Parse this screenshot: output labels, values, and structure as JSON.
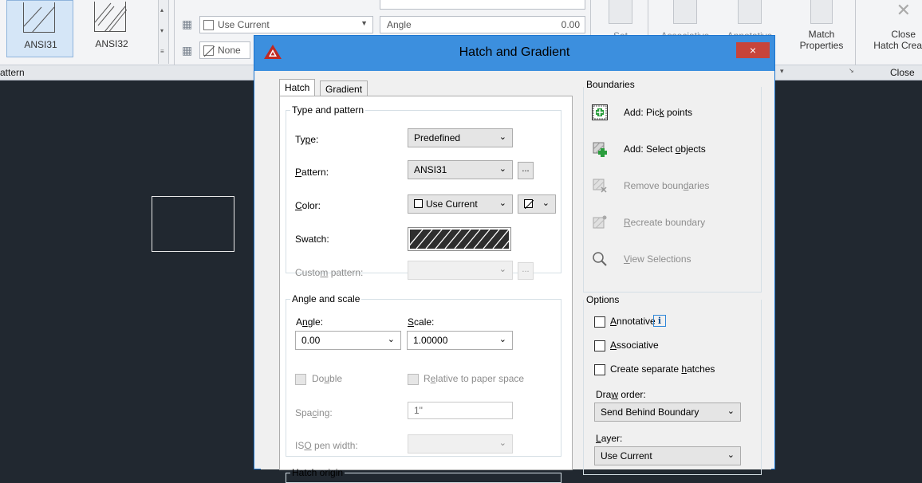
{
  "ribbon": {
    "patterns": [
      {
        "label": "ANSI31",
        "selected": true
      },
      {
        "label": "ANSI32",
        "selected": false
      }
    ],
    "layer_color": "Use Current",
    "bg_color": "None",
    "angle_label": "Angle",
    "angle_value": "0.00",
    "set_label": "Set",
    "associative_label": "Associative",
    "annotative_label": "Annotative",
    "match_props_label_1": "Match",
    "match_props_label_2": "Properties",
    "close_label_1": "Close",
    "close_label_2": "Hatch Crea",
    "footer_pattern": "attern",
    "footer_close": "Close"
  },
  "dialog": {
    "title": "Hatch and Gradient",
    "close_glyph": "×",
    "tabs": [
      {
        "label": "Hatch",
        "active": true
      },
      {
        "label": "Gradient",
        "active": false
      }
    ],
    "type_pattern": {
      "legend": "Type and pattern",
      "type_label": "Type:",
      "type_value": "Predefined",
      "pattern_label": "Pattern:",
      "pattern_value": "ANSI31",
      "color_label": "Color:",
      "color_value": "Use Current",
      "swatch_label": "Swatch:",
      "custom_label": "Custom pattern:",
      "ellipsis": "..."
    },
    "angle_scale": {
      "legend": "Angle and scale",
      "angle_label": "Angle:",
      "angle_value": "0.00",
      "scale_label": "Scale:",
      "scale_value": "1.00000",
      "double_label": "Double",
      "relative_label": "Relative to paper space",
      "spacing_label": "Spacing:",
      "spacing_value": "1\"",
      "iso_label": "ISO pen width:"
    },
    "hatch_origin_legend": "Hatch origin",
    "boundaries": {
      "legend": "Boundaries",
      "add_pick": "Add: Pick points",
      "add_select": "Add: Select objects",
      "remove": "Remove boundaries",
      "recreate": "Recreate boundary",
      "view": "View Selections"
    },
    "options": {
      "legend": "Options",
      "annotative": "Annotative",
      "info_glyph": "i",
      "associative": "Associative",
      "separate": "Create separate hatches",
      "draw_order_label": "Draw order:",
      "draw_order_value": "Send Behind Boundary",
      "layer_label": "Layer:",
      "layer_value": "Use Current"
    }
  },
  "colors": {
    "canvas": "#212830",
    "title_bar": "#3c8fde",
    "close_button": "#c7443a"
  }
}
